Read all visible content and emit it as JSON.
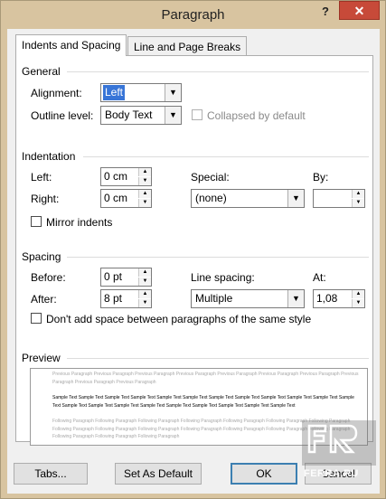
{
  "window": {
    "title": "Paragraph",
    "help": "?",
    "close": "✕"
  },
  "tabs": [
    {
      "label": "Indents and Spacing",
      "active": true
    },
    {
      "label": "Line and Page Breaks",
      "active": false
    }
  ],
  "general": {
    "heading": "General",
    "alignment_label": "Alignment:",
    "alignment_value": "Left",
    "outline_label": "Outline level:",
    "outline_value": "Body Text",
    "collapsed_label": "Collapsed by default"
  },
  "indentation": {
    "heading": "Indentation",
    "left_label": "Left:",
    "left_value": "0 cm",
    "right_label": "Right:",
    "right_value": "0 cm",
    "special_label": "Special:",
    "special_value": "(none)",
    "by_label": "By:",
    "by_value": "",
    "mirror_label": "Mirror indents"
  },
  "spacing": {
    "heading": "Spacing",
    "before_label": "Before:",
    "before_value": "0 pt",
    "after_label": "After:",
    "after_value": "8 pt",
    "line_spacing_label": "Line spacing:",
    "line_spacing_value": "Multiple",
    "at_label": "At:",
    "at_value": "1,08",
    "dont_add_label": "Don't add space between paragraphs of the same style"
  },
  "preview": {
    "heading": "Preview",
    "previous": "Previous Paragraph Previous Paragraph Previous Paragraph Previous Paragraph Previous Paragraph Previous Paragraph Previous Paragraph Previous Paragraph Previous Paragraph Previous Paragraph",
    "sample": "Sample Text Sample Text Sample Text Sample Text Sample Text Sample Text Sample Text Sample Text Sample Text Sample Text Sample Text Sample Text Sample Text Sample Text Sample Text Sample Text Sample Text Sample Text Sample Text Sample Text Sample Text",
    "following": "Following Paragraph Following Paragraph Following Paragraph Following Paragraph Following Paragraph Following Paragraph Following Paragraph Following Paragraph Following Paragraph Following Paragraph Following Paragraph Following Paragraph Following Paragraph Following Paragraph Following Paragraph Following Paragraph Following Paragraph"
  },
  "buttons": {
    "tabs": "Tabs...",
    "set_default": "Set As Default",
    "ok": "OK",
    "cancel": "Cancel"
  },
  "watermark": {
    "text": "FERRA.RU"
  }
}
